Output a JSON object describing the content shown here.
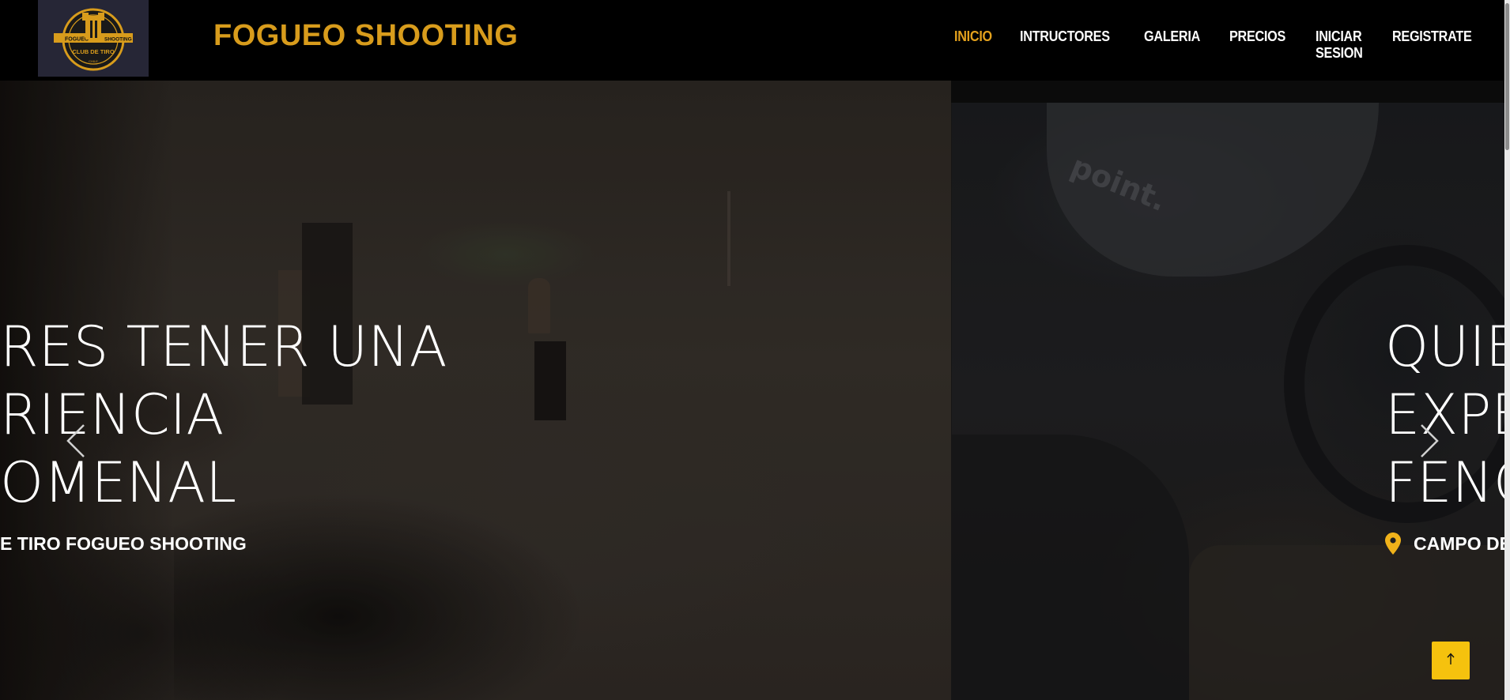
{
  "header": {
    "brand": "FOGUEO SHOOTING",
    "logo": {
      "top_left": "FOGUEO",
      "top_right": "SHOOTING",
      "bottom": "CLUB DE TIRO",
      "foot": "CHILE"
    },
    "nav": [
      {
        "label": "INICIO",
        "active": true
      },
      {
        "label": "INTRUCTORES",
        "active": false
      },
      {
        "label": "GALERIA",
        "active": false
      },
      {
        "label": "PRECIOS",
        "active": false
      },
      {
        "label": "INICIAR SESION",
        "active": false
      },
      {
        "label": "REGISTRATE",
        "active": false
      }
    ]
  },
  "slide_left": {
    "lines": [
      "RES TENER UNA",
      "RIENCIA",
      "OMENAL"
    ],
    "subtitle": "E TIRO FOGUEO SHOOTING"
  },
  "slide_right": {
    "cap_text": "point.",
    "lines": [
      "QUIE",
      "EXPE",
      "FENC"
    ],
    "subtitle": "CAMPO DE"
  },
  "icons": {
    "prev": "chevron-left-icon",
    "next": "chevron-right-icon",
    "location": "map-pin-icon",
    "back_to_top": "arrow-up-icon"
  },
  "colors": {
    "brand": "#d89c1c",
    "nav_active": "#e3a11d",
    "back_to_top_bg": "#f5c20e"
  }
}
